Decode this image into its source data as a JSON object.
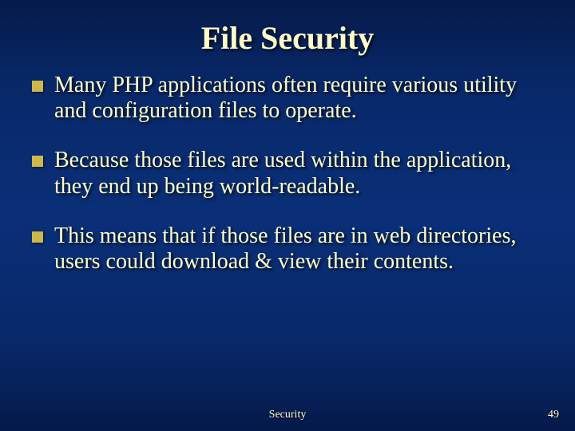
{
  "title": "File Security",
  "bullets": [
    "Many PHP applications often require various utility and configuration files to operate.",
    "Because those files are used within the application, they end up being world-readable.",
    "This means that if those files are in web directories, users could download & view their contents."
  ],
  "footer": {
    "center": "Security",
    "page": "49"
  }
}
